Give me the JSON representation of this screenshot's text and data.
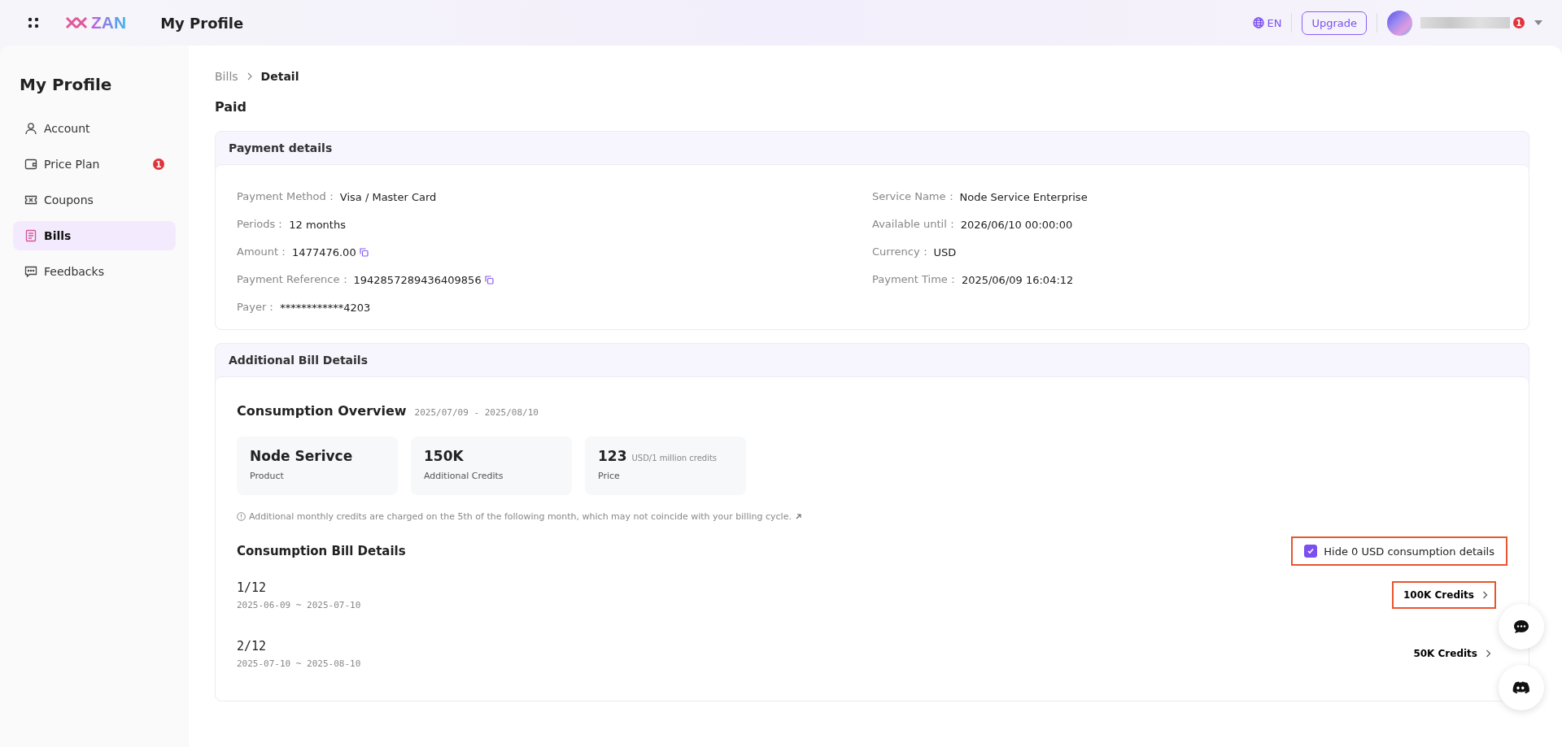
{
  "header": {
    "logo": "ZAN",
    "title": "My Profile",
    "language": "EN",
    "upgrade": "Upgrade",
    "notification_count": "1"
  },
  "sidebar": {
    "title": "My Profile",
    "items": [
      {
        "label": "Account",
        "selected": false
      },
      {
        "label": "Price Plan",
        "selected": false,
        "badge": "1"
      },
      {
        "label": "Coupons",
        "selected": false
      },
      {
        "label": "Bills",
        "selected": true
      },
      {
        "label": "Feedbacks",
        "selected": false
      }
    ]
  },
  "breadcrumb": [
    "Bills",
    "Detail"
  ],
  "status": "Paid",
  "payment": {
    "title": "Payment details",
    "left": [
      {
        "label": "Payment Method：",
        "value": "Visa / Master Card",
        "copy": false
      },
      {
        "label": "Periods：",
        "value": "12 months",
        "copy": false
      },
      {
        "label": "Amount：",
        "value": "1477476.00",
        "copy": true
      },
      {
        "label": "Payment Reference：",
        "value": "1942857289436409856",
        "copy": true
      },
      {
        "label": "Payer：",
        "value": "************4203",
        "copy": false
      }
    ],
    "right": [
      {
        "label": "Service Name：",
        "value": "Node Service Enterprise",
        "copy": false
      },
      {
        "label": "Available until：",
        "value": "2026/06/10 00:00:00",
        "copy": false
      },
      {
        "label": "Currency：",
        "value": "USD",
        "copy": false
      },
      {
        "label": "Payment Time：",
        "value": "2025/06/09 16:04:12",
        "copy": false
      }
    ]
  },
  "additional": {
    "title": "Additional Bill Details",
    "overview_title": "Consumption Overview",
    "overview_range": "2025/07/09 - 2025/08/10",
    "stats": [
      {
        "value": "Node Serivce",
        "label": "Product"
      },
      {
        "value": "150K",
        "label": "Additional Credits"
      },
      {
        "value": "123",
        "unit": "USD/1 million credits",
        "label": "Price"
      }
    ],
    "note": "Additional monthly credits are charged on the 5th of the following month, which may not coincide with your billing cycle.",
    "bills_title": "Consumption Bill Details",
    "hide_zero": {
      "label": "Hide 0 USD consumption details",
      "checked": true,
      "highlighted": true
    },
    "bills": [
      {
        "period": "1/12",
        "range": "2025-06-09 ~ 2025-07-10",
        "credits": "100K Credits",
        "highlighted": true
      },
      {
        "period": "2/12",
        "range": "2025-07-10 ~ 2025-08-10",
        "credits": "50K Credits",
        "highlighted": false
      }
    ]
  }
}
